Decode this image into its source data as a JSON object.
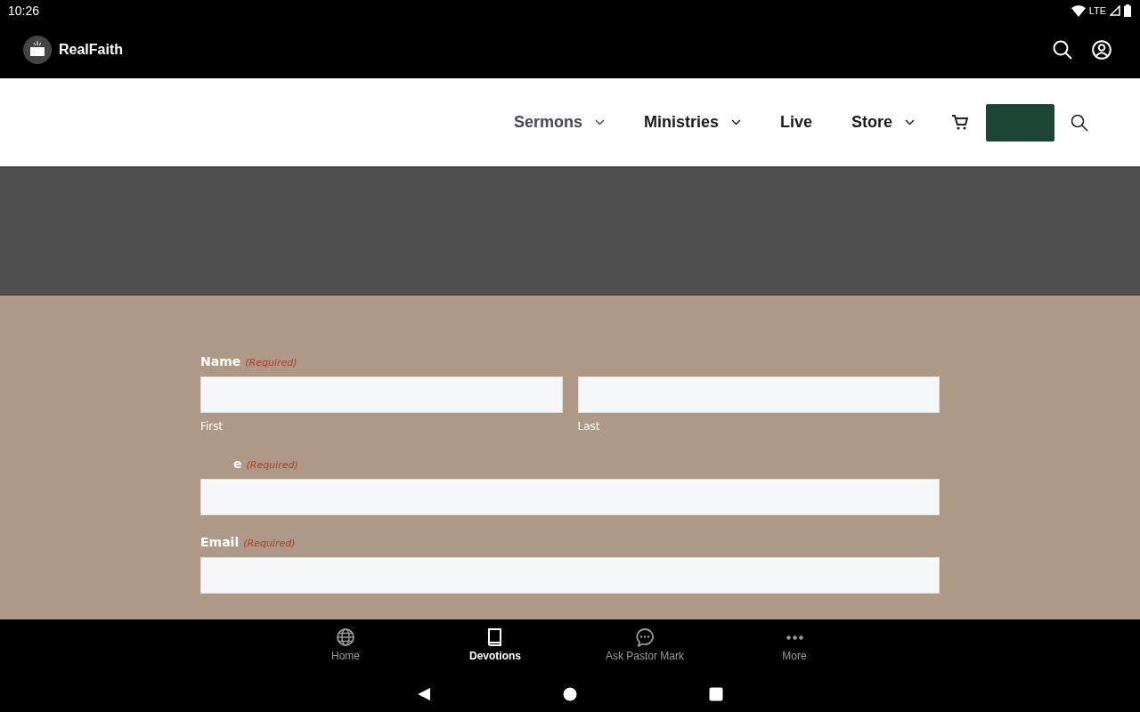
{
  "status_bar": {
    "time": "10:26",
    "network": "LTE"
  },
  "app_bar": {
    "title": "RealFaith"
  },
  "site_nav": {
    "items": [
      {
        "label": "Sermons",
        "dropdown": true,
        "selected": true
      },
      {
        "label": "Ministries",
        "dropdown": true,
        "selected": false
      },
      {
        "label": "Live",
        "dropdown": false,
        "selected": false
      },
      {
        "label": "Store",
        "dropdown": true,
        "selected": false
      }
    ]
  },
  "form": {
    "fields": [
      {
        "kind": "name",
        "label": "Name",
        "required": "(Required)",
        "sublabels": [
          "First",
          "Last"
        ]
      },
      {
        "kind": "single",
        "label": "e",
        "required": "(Required)",
        "indent": true
      },
      {
        "kind": "single",
        "label": "Email",
        "required": "(Required)",
        "indent": false
      }
    ]
  },
  "bottom_nav": {
    "items": [
      {
        "label": "Home",
        "selected": false
      },
      {
        "label": "Devotions",
        "selected": true
      },
      {
        "label": "Ask Pastor Mark",
        "selected": false
      },
      {
        "label": "More",
        "selected": false
      }
    ]
  }
}
